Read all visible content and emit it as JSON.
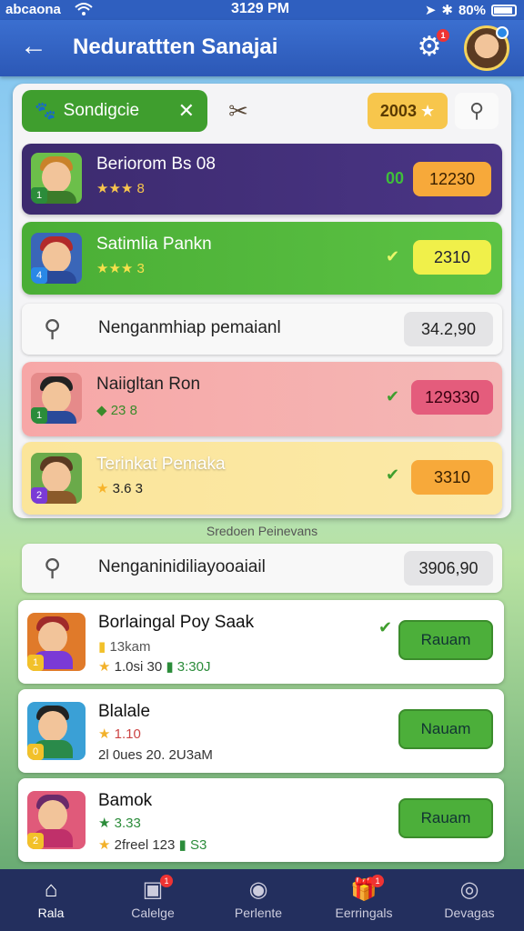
{
  "status_bar": {
    "carrier": "abcaona",
    "time": "3129 PM",
    "battery": "80%"
  },
  "header": {
    "title": "Nedurattten Sanajai",
    "settings_badge": "1"
  },
  "filter": {
    "chip_label": "Sondigcie",
    "coin_value": "2003"
  },
  "top_cards": [
    {
      "name": "Beriorom Bs 08",
      "rating": "★★★ 8",
      "value": "12230",
      "check": "00"
    },
    {
      "name": "Satimlia Pankn",
      "rating": "★★★ 3",
      "value": "2310"
    }
  ],
  "search_rows": [
    {
      "text": "Nenganmhiap pemaianl",
      "value": "34.2,90"
    },
    {
      "text": "Nenganinidiliayooaiail",
      "value": "3906,90"
    }
  ],
  "mid_cards": [
    {
      "name": "Naiigltan Ron",
      "sub": "23 8",
      "value": "129330"
    },
    {
      "name": "Terinkat Pemaka",
      "sub": "3.6 3",
      "value": "3310"
    }
  ],
  "section_label": "Sredoen Peinevans",
  "players": [
    {
      "name": "Borlaingal Poy Saak",
      "line1": "13kam",
      "line2": "1.0si 30",
      "line3": "3:30J",
      "button": "Rauam"
    },
    {
      "name": "Blalale",
      "line1": "1.10",
      "line2": "2l 0ues 20. 2U3aM",
      "button": "Nauam"
    },
    {
      "name": "Bamok",
      "line1": "3.33",
      "line2": "2freel 123",
      "line3": "S3",
      "button": "Rauam"
    }
  ],
  "nav": [
    {
      "label": "Rala",
      "icon": "home-icon"
    },
    {
      "label": "Calelge",
      "icon": "cards-icon",
      "badge": "1"
    },
    {
      "label": "Perlente",
      "icon": "cookie-icon"
    },
    {
      "label": "Eerringals",
      "icon": "gift-icon",
      "badge": "1"
    },
    {
      "label": "Devagas",
      "icon": "circle-icon"
    }
  ]
}
